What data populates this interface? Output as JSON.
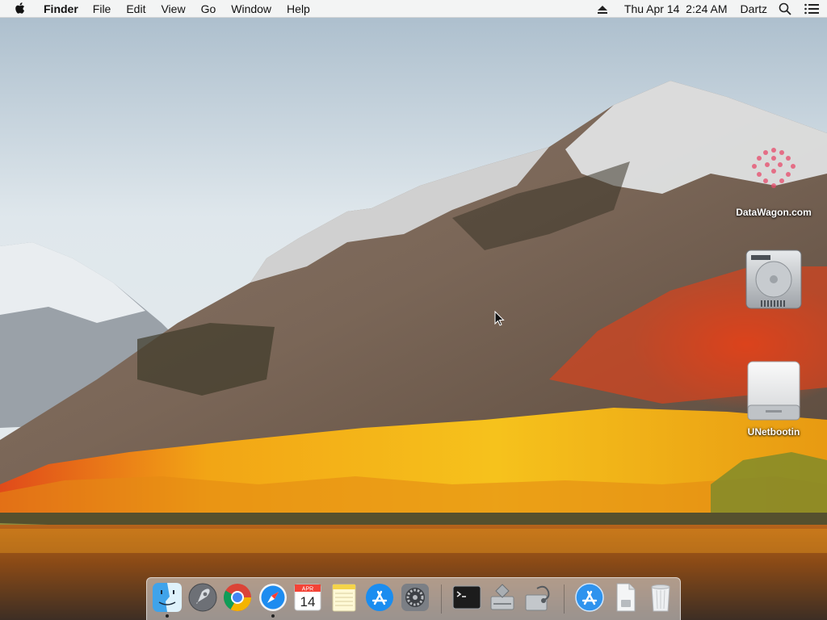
{
  "menubar": {
    "app_name": "Finder",
    "menus": [
      "File",
      "Edit",
      "View",
      "Go",
      "Window",
      "Help"
    ],
    "clock": "Thu Apr 14  2:24 AM",
    "user": "Dartz"
  },
  "desktop": {
    "icons": [
      {
        "label": "DataWagon.com",
        "icon": "datawagon-logo-icon"
      },
      {
        "label": "",
        "icon": "hard-drive-icon"
      },
      {
        "label": "UNetbootin",
        "icon": "external-drive-icon"
      }
    ]
  },
  "dock": {
    "items": [
      {
        "name": "Finder",
        "icon": "finder-icon",
        "running": true
      },
      {
        "name": "Launchpad",
        "icon": "launchpad-icon",
        "running": false
      },
      {
        "name": "Google Chrome",
        "icon": "chrome-icon",
        "running": false
      },
      {
        "name": "Safari",
        "icon": "safari-icon",
        "running": true
      },
      {
        "name": "Calendar",
        "icon": "calendar-icon",
        "running": false,
        "month": "APR",
        "day": "14"
      },
      {
        "name": "Notes",
        "icon": "notes-icon",
        "running": false
      },
      {
        "name": "App Store",
        "icon": "app-store-icon",
        "running": false
      },
      {
        "name": "System Preferences",
        "icon": "system-preferences-icon",
        "running": false
      },
      {
        "name": "Terminal",
        "icon": "terminal-icon",
        "running": false
      },
      {
        "name": "Boot Camp Assistant",
        "icon": "boot-camp-icon",
        "running": false
      },
      {
        "name": "Disk Utility",
        "icon": "disk-utility-icon",
        "running": false
      },
      {
        "name": "Downloads",
        "icon": "downloads-folder-icon",
        "running": false
      },
      {
        "name": "Documents",
        "icon": "document-file-icon",
        "running": false
      },
      {
        "name": "Trash",
        "icon": "trash-icon",
        "running": false
      }
    ]
  },
  "colors": {
    "menubar_bg": "#f6f6f6",
    "dock_bg": "#e6e6e8",
    "label_text": "#ffffff"
  }
}
